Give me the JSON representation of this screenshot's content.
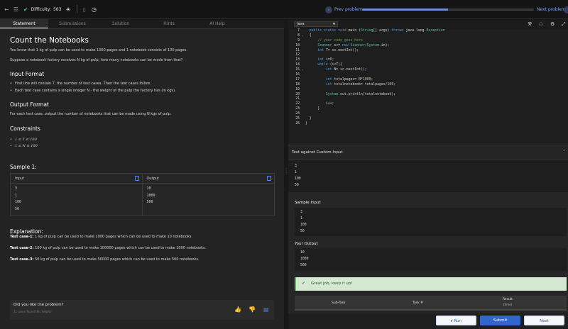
{
  "topbar": {
    "difficulty_label": "Difficulty:",
    "difficulty_value": "563",
    "prev_label": "Prev problem",
    "next_label": "Next problem",
    "progress_fraction": 0.5
  },
  "tabs": [
    "Statement",
    "Submissions",
    "Solution",
    "Hints",
    "AI Help"
  ],
  "problem": {
    "title": "Count the Notebooks",
    "intro_1": "You know that 1 kg of pulp can be used to make 1000 pages and 1 notebook consists of 100 pages.",
    "intro_2": "Suppose a notebook factory receives N kg of pulp, how many notebooks can be made from that?",
    "input_format_heading": "Input Format",
    "input_format_1": "First line will contain T, the number of test cases. Then the test cases follow.",
    "input_format_2": "Each test case contains a single integer N - the weight of the pulp the factory has (in kgs).",
    "output_format_heading": "Output Format",
    "output_format_1": "For each test case, output the number of notebooks that can be made using N kgs of pulp.",
    "constraints_heading": "Constraints",
    "constraint_1": "1 ≤ T ≤ 100",
    "constraint_2": "1 ≤ N ≤ 100",
    "sample_heading": "Sample 1:",
    "sample_input_label": "Input",
    "sample_output_label": "Output",
    "sample_input_lines": [
      "3",
      "1",
      "100",
      "50"
    ],
    "sample_output_lines": [
      "10",
      "1000",
      "500"
    ],
    "explanation_heading": "Explanation:",
    "case_1_label": "Test case-1:",
    "case_1_text": "1 kg of pulp can be used to make 1000 pages which can be used to make 10 notebooks.",
    "case_2_label": "Test case-2:",
    "case_2_text": "100 kg of pulp can be used to make 100000 pages which can be used to make 1000 notebooks.",
    "case_3_label": "Test case-3:",
    "case_3_text": "50 kg of pulp can be used to make 50000 pages which can be used to make 500 notebooks."
  },
  "feedback": {
    "question": "Did you like the problem?",
    "subtext": "11 users found this helpful"
  },
  "editor": {
    "language": "Java",
    "line_numbers": [
      "7",
      "8",
      "9",
      "10",
      "11",
      "12",
      "13",
      "14",
      "15",
      "16",
      "17",
      "18",
      "19",
      "20",
      "21",
      "22",
      "23",
      "24",
      "25",
      "26"
    ]
  },
  "custom_input": {
    "heading": "Test against Custom Input",
    "lines": [
      "3",
      "1",
      "100",
      "50"
    ]
  },
  "results": {
    "sample_input_label": "Sample Input",
    "sample_input_lines": [
      "3",
      "1",
      "100",
      "50"
    ],
    "your_output_label": "Your Output",
    "your_output_lines": [
      "10",
      "1000",
      "500"
    ],
    "success_message": "Great job, keep it up!",
    "table_headers": [
      "Sub-Task",
      "Task #",
      "Result",
      "(time)"
    ]
  },
  "actions": {
    "run_label": "Run",
    "submit_label": "Submit",
    "next_label": "Next"
  }
}
